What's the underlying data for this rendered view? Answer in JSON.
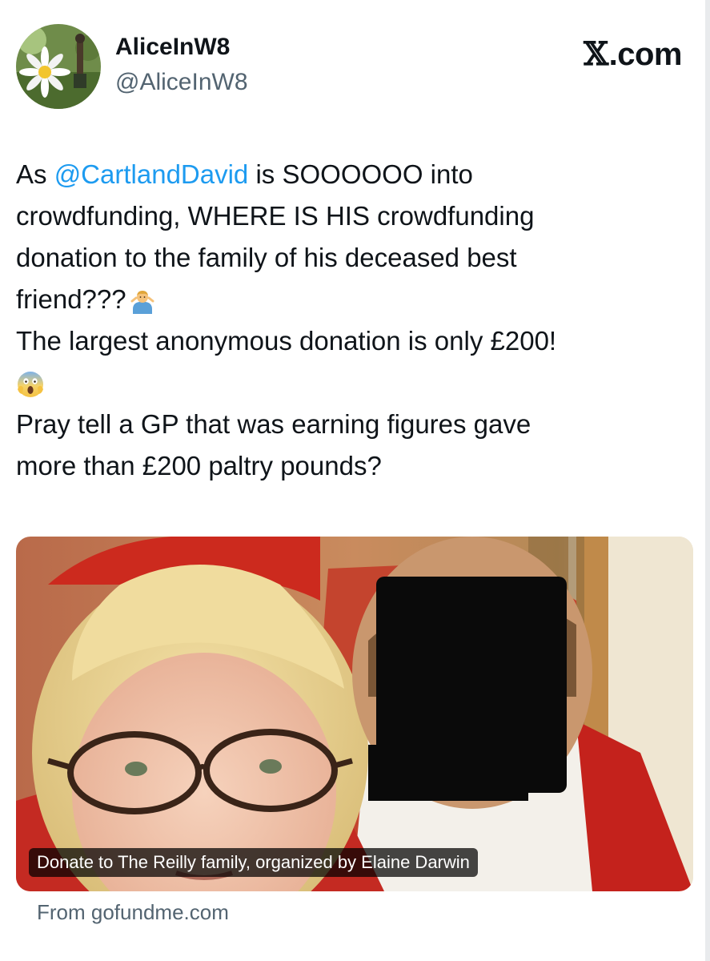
{
  "author": {
    "display_name": "AliceInW8",
    "handle": "@AliceInW8"
  },
  "brand": {
    "mark": "𝕏",
    "domain": ".com"
  },
  "tweet": {
    "line1_prefix": "As ",
    "mention": "@CartlandDavid",
    "line1_suffix": " is SOOOOOO into",
    "line2": "crowdfunding, WHERE IS HIS crowdfunding",
    "line3": "donation to the family of his deceased best",
    "line4": "friend???",
    "line4_emoji": "person-shrugging-emoji",
    "line5": "The largest anonymous donation is only £200!",
    "line6_emoji": "face-screaming-in-fear-emoji",
    "line7": "Pray tell a GP that was earning figures gave",
    "line8": "more than £200 paltry pounds?"
  },
  "link_card": {
    "caption": "Donate to The Reilly family, organized by Elaine Darwin",
    "source": "From gofundme.com"
  },
  "colors": {
    "text": "#0f1419",
    "secondary_text": "#536471",
    "mention_blue": "#1d9bf0",
    "background": "#ffffff"
  }
}
